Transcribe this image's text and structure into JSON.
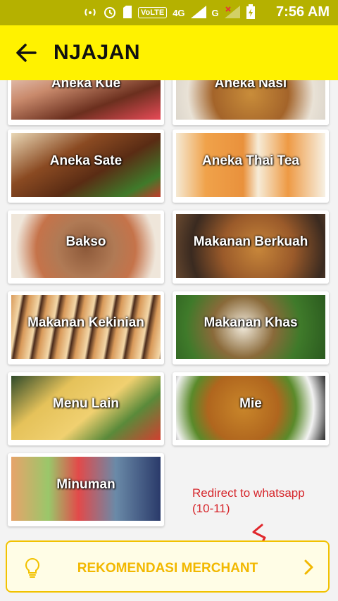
{
  "status_bar": {
    "time": "7:56 AM",
    "volte": "VoLTE",
    "network_4g": "4G",
    "network_g": "G"
  },
  "app_bar": {
    "title": "NJAJAN"
  },
  "categories": [
    {
      "label": "Aneka Kue"
    },
    {
      "label": "Aneka Nasi"
    },
    {
      "label": "Aneka Sate"
    },
    {
      "label": "Aneka Thai Tea"
    },
    {
      "label": "Bakso"
    },
    {
      "label": "Makanan Berkuah"
    },
    {
      "label": "Makanan Kekinian"
    },
    {
      "label": "Makanan Khas"
    },
    {
      "label": "Menu Lain"
    },
    {
      "label": "Mie"
    },
    {
      "label": "Minuman"
    }
  ],
  "annotation": {
    "line1": "Redirect to whatsapp",
    "line2": "(10-11)"
  },
  "bottom_button": {
    "label": "REKOMENDASI MERCHANT"
  },
  "colors": {
    "appbar": "#fff200",
    "accent": "#f2b800",
    "note": "#d6262b"
  }
}
